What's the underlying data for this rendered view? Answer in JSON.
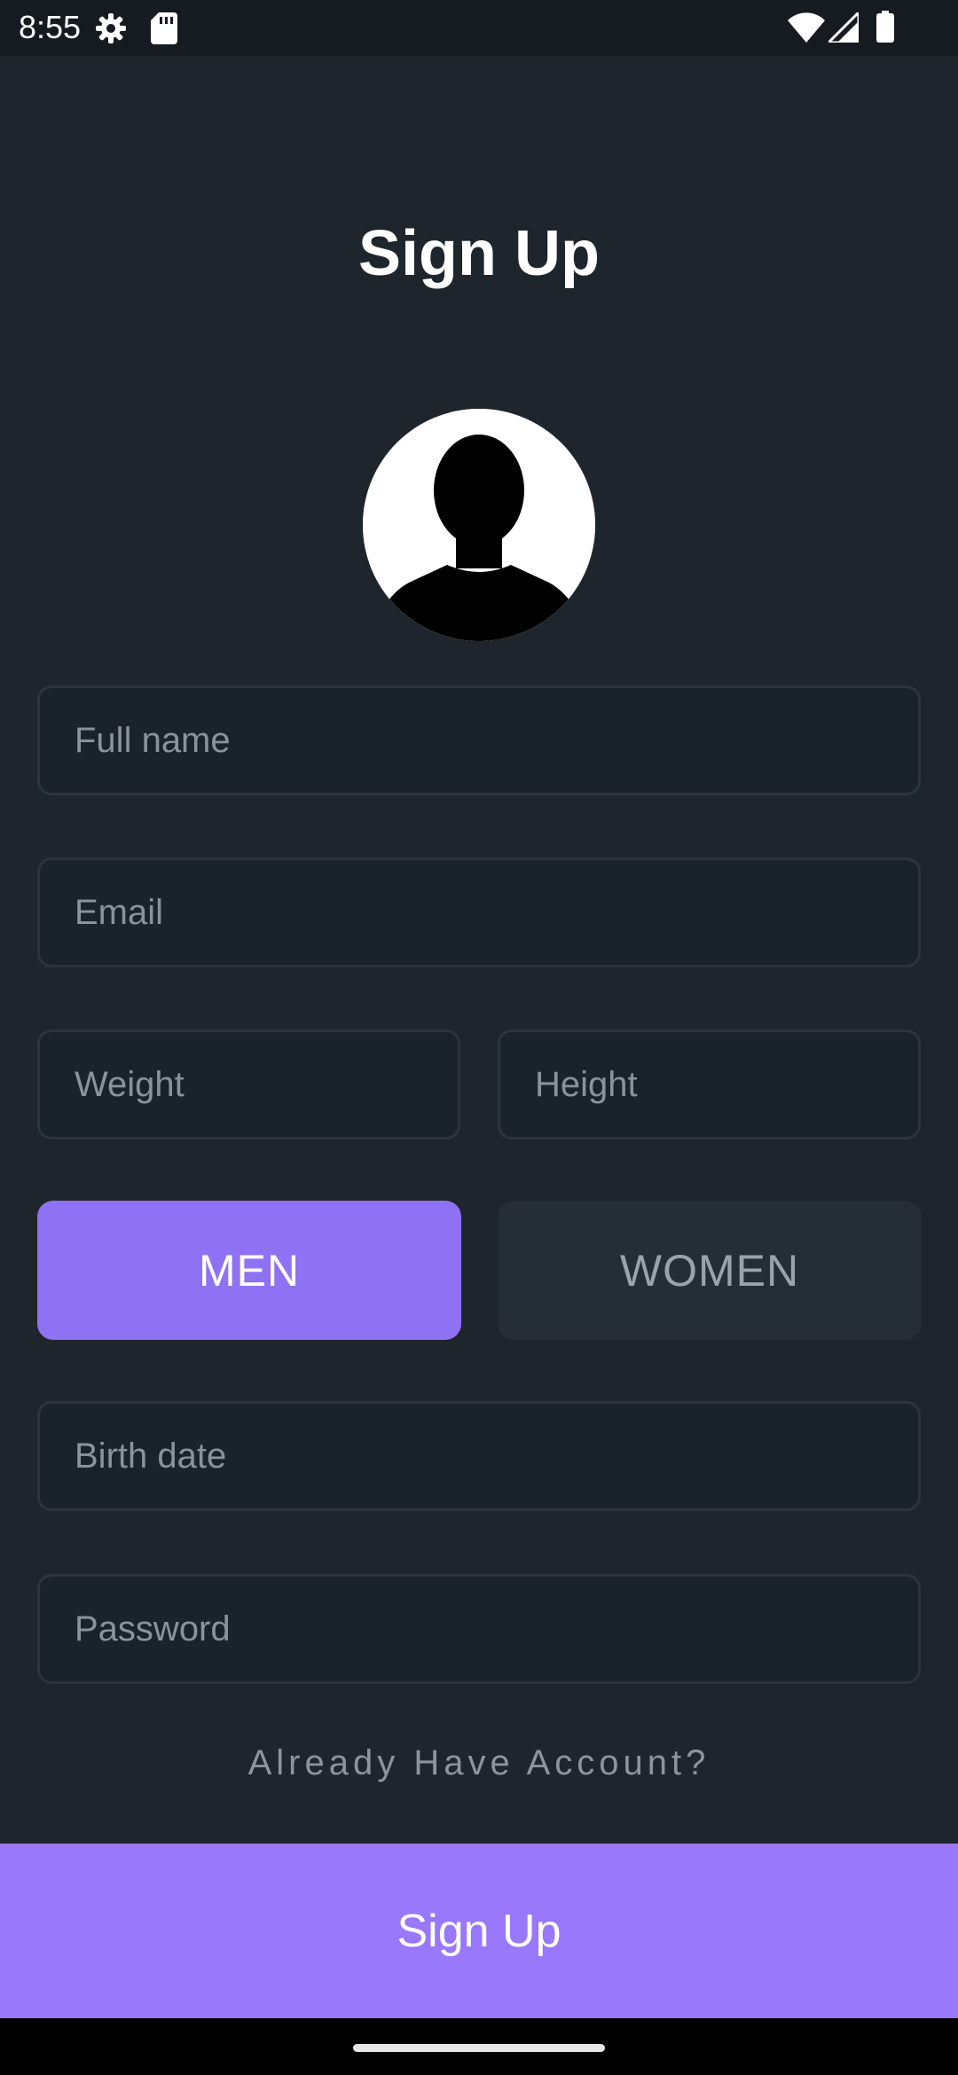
{
  "status_bar": {
    "time": "8:55",
    "icons": [
      "settings-icon",
      "sd-card-icon",
      "wifi-icon",
      "cellular-signal-icon",
      "battery-icon"
    ]
  },
  "page": {
    "title": "Sign Up"
  },
  "avatar": {
    "icon": "person-silhouette-icon"
  },
  "form": {
    "full_name": {
      "placeholder": "Full name",
      "value": ""
    },
    "email": {
      "placeholder": "Email",
      "value": ""
    },
    "weight": {
      "placeholder": "Weight",
      "value": ""
    },
    "height": {
      "placeholder": "Height",
      "value": ""
    },
    "birth_date": {
      "placeholder": "Birth date",
      "value": ""
    },
    "password": {
      "placeholder": "Password",
      "value": ""
    }
  },
  "gender": {
    "options": [
      "MEN",
      "WOMEN"
    ],
    "selected": "MEN"
  },
  "login_link": "Already Have Account?",
  "signup_button": "Sign Up",
  "colors": {
    "background": "#1e252c",
    "accent": "#9978fc",
    "selected_toggle": "#8f71f4",
    "unselected_toggle": "#252d35",
    "placeholder_text": "#8a939c"
  }
}
